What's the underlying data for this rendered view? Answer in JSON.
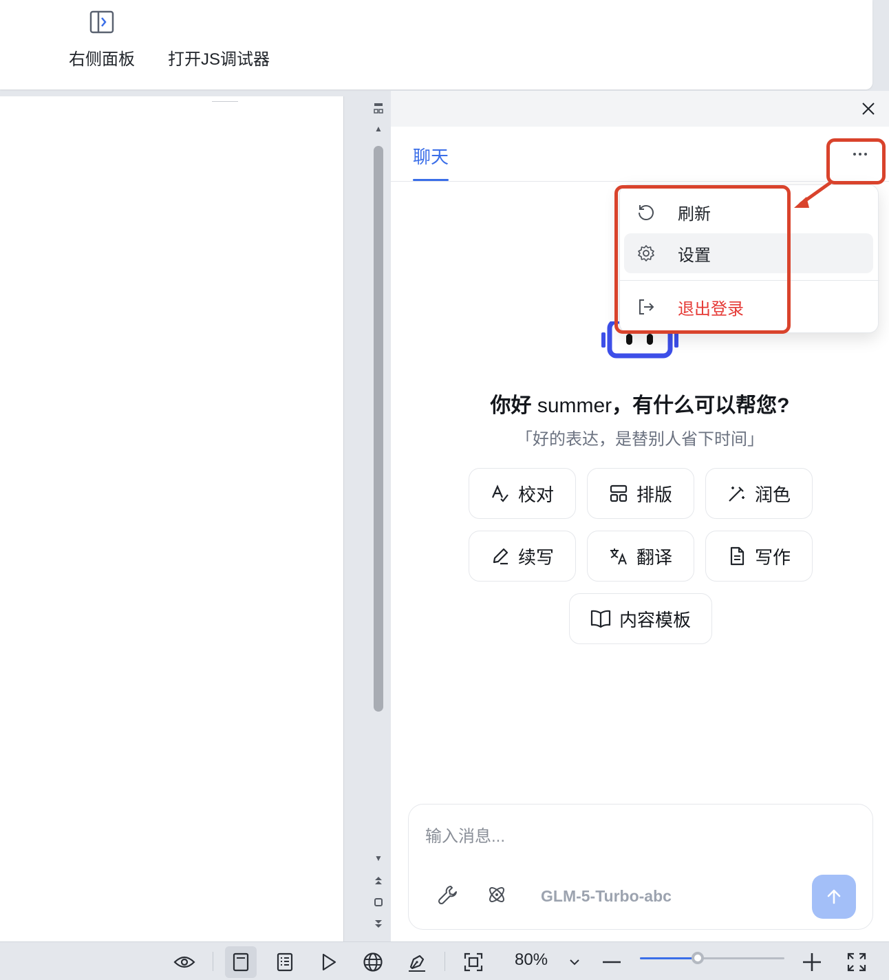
{
  "ribbon": {
    "right_panel_label": "右侧面板",
    "js_debugger_label": "打开JS调试器"
  },
  "panel": {
    "tab_chat": "聊天",
    "greeting_prefix": "你好 ",
    "greeting_name": "summer",
    "greeting_suffix": "，有什么可以帮您?",
    "subtitle": "「好的表达，是替别人省下时间」",
    "actions": {
      "proofread": "校对",
      "layout": "排版",
      "polish": "润色",
      "continue": "续写",
      "translate": "翻译",
      "write": "写作",
      "templates": "内容模板"
    },
    "composer": {
      "placeholder": "输入消息...",
      "model": "GLM-5-Turbo-abc"
    }
  },
  "menu": {
    "refresh": "刷新",
    "settings": "设置",
    "logout": "退出登录"
  },
  "statusbar": {
    "zoom": "80%",
    "zoom_fraction": 0.4
  },
  "colors": {
    "accent": "#3a6ee8",
    "danger": "#e53935",
    "annotation": "#d9432c",
    "send_disabled": "#a3bff8"
  }
}
